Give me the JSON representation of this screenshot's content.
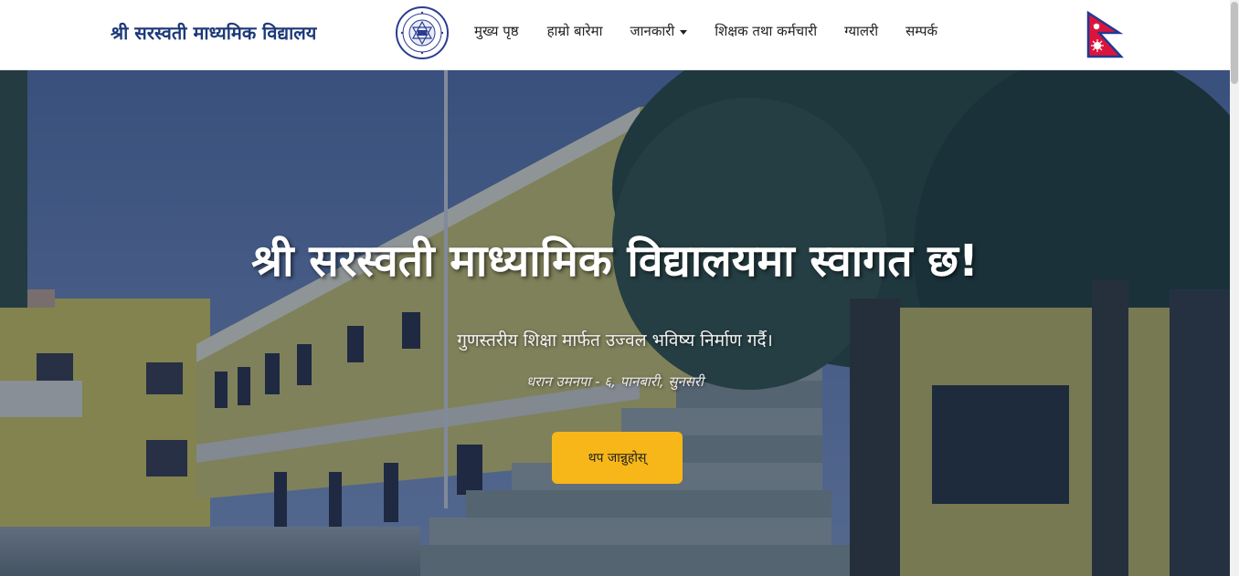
{
  "header": {
    "brand_name": "श्री सरस्वती माध्यमिक विद्यालय",
    "logo_icon": "school-seal-logo",
    "flag_icon": "nepal-flag-icon",
    "nav": [
      {
        "label": "मुख्य पृष्ठ"
      },
      {
        "label": "हाम्रो बारेमा"
      },
      {
        "label": "जानकारी",
        "has_dropdown": true
      },
      {
        "label": "शिक्षक तथा कर्मचारी"
      },
      {
        "label": "ग्यालरी"
      },
      {
        "label": "सम्पर्क"
      }
    ]
  },
  "hero": {
    "title": "श्री सरस्वती माध्यामिक विद्यालयमा स्वागत छ!",
    "subtitle": "गुणस्तरीय शिक्षा मार्फत उज्वल भविष्य निर्माण गर्दै।",
    "location": "धरान उमनपा - ६, पानबारी, सुनसरी",
    "button_label": "थप जान्नुहोस्"
  },
  "colors": {
    "brand": "#1d3a78",
    "button": "#f7b718",
    "header_bg": "#ffffff",
    "nav_text": "#222222"
  }
}
